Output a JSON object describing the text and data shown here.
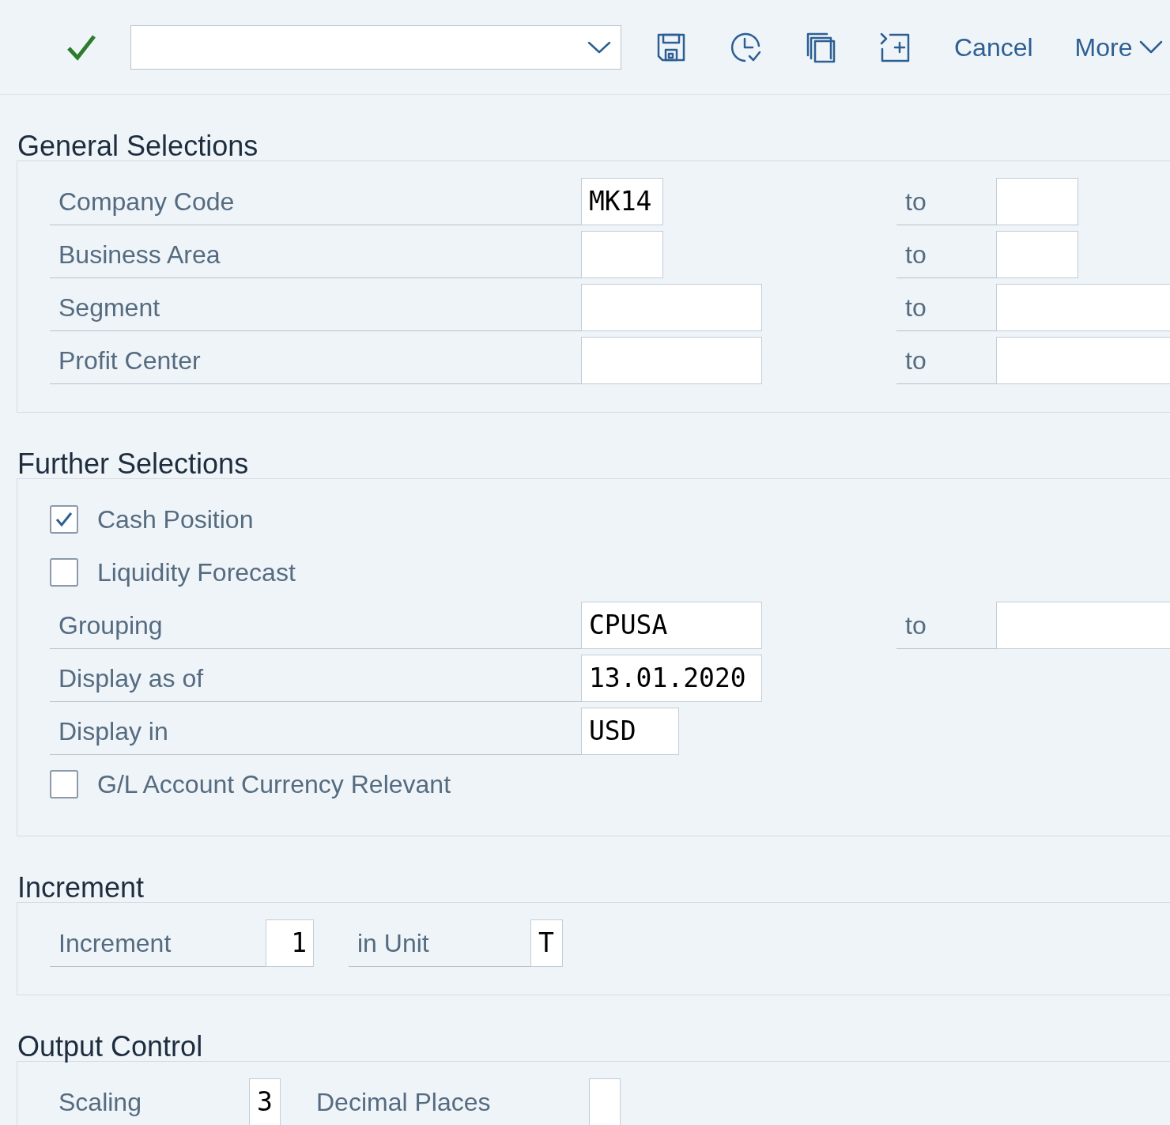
{
  "toolbar": {
    "actions": [
      "Cancel",
      "More"
    ]
  },
  "sections": [
    {
      "title": "General Selections",
      "rows": [
        {
          "kind": "range",
          "label": "Company Code",
          "value": "MK14",
          "to_label": "to"
        },
        {
          "kind": "range",
          "label": "Business Area",
          "to_label": "to"
        },
        {
          "kind": "range",
          "label": "Segment",
          "to_label": "to"
        },
        {
          "kind": "range",
          "label": "Profit Center",
          "to_label": "to"
        }
      ]
    },
    {
      "title": "Further Selections",
      "rows": [
        {
          "kind": "checkbox",
          "label": "Cash Position",
          "checked": true
        },
        {
          "kind": "checkbox",
          "label": "Liquidity Forecast",
          "checked": false
        },
        {
          "kind": "range",
          "label": "Grouping",
          "value": "CPUSA",
          "to_label": "to"
        },
        {
          "kind": "field",
          "label": "Display as of",
          "value": "13.01.2020"
        },
        {
          "kind": "field",
          "label": "Display in",
          "value": "USD"
        },
        {
          "kind": "checkbox",
          "label": "G/L Account Currency Relevant",
          "checked": false
        }
      ]
    },
    {
      "title": "Increment",
      "rows": [
        {
          "kind": "pair",
          "label": "Increment",
          "value": "1",
          "label_2": "in Unit",
          "value_2": "T"
        }
      ]
    },
    {
      "title": "Output Control",
      "rows": [
        {
          "kind": "pair",
          "label": "Scaling",
          "value": "3",
          "label_2": "Decimal Places"
        }
      ]
    }
  ]
}
